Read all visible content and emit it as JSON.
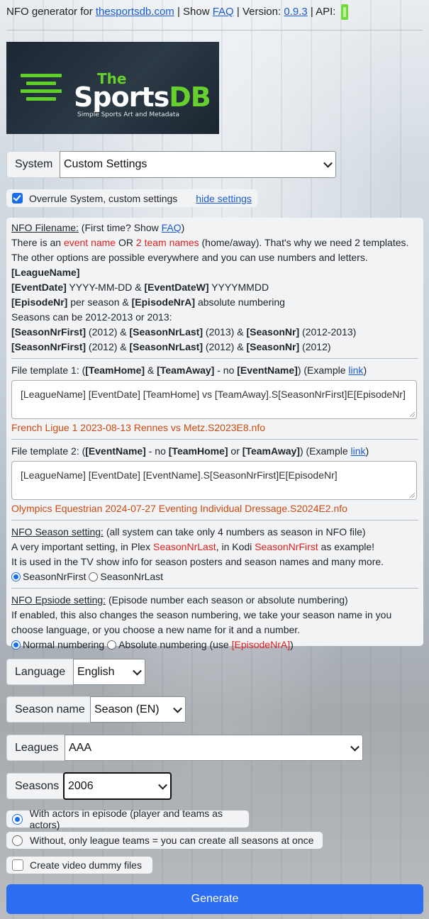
{
  "topbar": {
    "prefix": "NFO generator for ",
    "site_link": "thesportsdb.com",
    "show_text": " | Show ",
    "faq_link": "FAQ",
    "version_text": " | Version: ",
    "version_link": "0.9.3",
    "api_text": " | API:"
  },
  "logo": {
    "the": "The",
    "sports": "Sports",
    "db": "DB",
    "tagline": "Simple Sports Art and Metadata"
  },
  "system": {
    "label": "System",
    "value": "Custom Settings"
  },
  "overrule": {
    "label": "Overrule System, custom settings",
    "hide_link": "hide settings"
  },
  "nfo_filename": {
    "heading": "NFO Filename:",
    "first_time": " (First time? Show ",
    "faq": "FAQ",
    "close": ")",
    "line2_a": "There is an ",
    "line2_event": "event name",
    "line2_or": " OR ",
    "line2_teams": "2 team names",
    "line2_b": " (home/away). That's why we need 2 templates.",
    "line3": "The other options are possible everywhere and you can use numbers and letters.",
    "league_token": "[LeagueName]",
    "eventdate_token": "[EventDate]",
    "eventdate_fmt": " YYYY-MM-DD & ",
    "eventdatew_token": "[EventDateW]",
    "eventdatew_fmt": " YYYYMMDD",
    "episodenr_token": "[EpisodeNr]",
    "episodenr_text": " per season & ",
    "episodenra_token": "[EpisodeNrA]",
    "episodenra_text": " absolute numbering",
    "seasons_line": "Seasons can be 2012-2013 or 2013:",
    "snf_token": "[SeasonNrFirst]",
    "snl_token": "[SeasonNrLast]",
    "sn_token": "[SeasonNr]",
    "row1_a": " (2012) & ",
    "row1_b": " (2013) & ",
    "row1_c": " (2012-2013)",
    "row2_a": " (2012) & ",
    "row2_b": " (2012) & ",
    "row2_c": " (2012)"
  },
  "template1": {
    "label_a": "File template 1: (",
    "team_home": "[TeamHome]",
    "amp": " & ",
    "team_away": "[TeamAway]",
    "no_text": " - no ",
    "event_name": "[EventName]",
    "example": ") (Example ",
    "link": "link",
    "close": ")",
    "value": "[LeagueName] [EventDate] [TeamHome] vs [TeamAway].S[SeasonNrFirst]E[EpisodeNr]",
    "preview": "French Ligue 1 2023-08-13 Rennes vs Metz.S2023E8.nfo"
  },
  "template2": {
    "label_a": "File template 2: (",
    "event_name": "[EventName]",
    "no_text": " - no ",
    "team_home": "[TeamHome]",
    "or": " or ",
    "team_away": "[TeamAway]",
    "example": ") (Example ",
    "link": "link",
    "close": ")",
    "value": "[LeagueName] [EventDate] [EventName].S[SeasonNrFirst]E[EpisodeNr]",
    "preview": "Olympics Equestrian 2024-07-27 Eventing Individual Dressage.S2024E2.nfo"
  },
  "season_setting": {
    "heading": "NFO Season setting:",
    "desc": " (all system can take only 4 numbers as season in NFO file)",
    "line2_a": "A very important setting, in Plex ",
    "plex_token": "SeasonNrLast",
    "line2_b": ", in Kodi ",
    "kodi_token": "SeasonNrFirst",
    "line2_c": " as example!",
    "line3": "It is used in the TV show info for season posters and season names and many more.",
    "opt1": "SeasonNrFirst",
    "opt2": "SeasonNrLast"
  },
  "episode_setting": {
    "heading": "NFO Epsiode setting:",
    "desc": " (Episode number each season or absolute numbering)",
    "line2": "If enabled, this also changes the season numbering, we take your season name in you",
    "line3": "choose language, or you choose a new name for it and a number.",
    "opt1": "Normal numbering",
    "opt2": "Absolute numbering (use ",
    "opt2_token": "[EpisodeNrA]",
    "opt2_close": ")"
  },
  "language": {
    "label": "Language",
    "value": "English"
  },
  "season_name": {
    "label": "Season name",
    "value": "Season (EN)"
  },
  "leagues": {
    "label": "Leagues",
    "value": "AAA"
  },
  "seasons": {
    "label": "Seasons",
    "value": "2006"
  },
  "actors": {
    "with_label": "With actors in episode (player and teams as actors)",
    "without_label": "Without, only league teams = you can create all seasons at once"
  },
  "dummy": {
    "label": "Create video dummy files"
  },
  "generate": {
    "label": "Generate"
  },
  "colors": {
    "accent": "#2d6df2",
    "red": "#e02020",
    "preview_orange": "#cc4a12",
    "api_green": "#6fdc3c"
  },
  "icons": {
    "api_status": "api-status-icon"
  }
}
